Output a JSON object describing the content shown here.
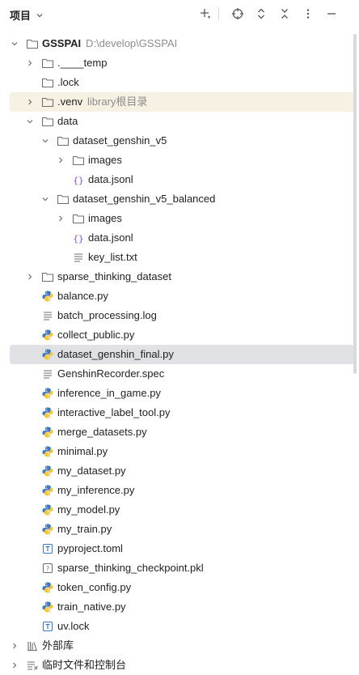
{
  "header": {
    "title": "项目"
  },
  "tree": [
    {
      "name": "root",
      "label": "GSSPAI",
      "path": "D:\\develop\\GSSPAI",
      "type": "folder",
      "depth": 0,
      "arrow": "down",
      "bold": true
    },
    {
      "name": "temp",
      "label": ".____temp",
      "type": "folder",
      "depth": 1,
      "arrow": "right"
    },
    {
      "name": "lock",
      "label": ".lock",
      "type": "folder",
      "depth": 1,
      "arrow": "none"
    },
    {
      "name": "venv",
      "label": ".venv",
      "path": "library根目录",
      "type": "folder",
      "depth": 1,
      "arrow": "right",
      "highlight": true
    },
    {
      "name": "data",
      "label": "data",
      "type": "folder",
      "depth": 1,
      "arrow": "down"
    },
    {
      "name": "dataset-genshin-v5",
      "label": "dataset_genshin_v5",
      "type": "folder",
      "depth": 2,
      "arrow": "down"
    },
    {
      "name": "images-1",
      "label": "images",
      "type": "folder",
      "depth": 3,
      "arrow": "right"
    },
    {
      "name": "data-jsonl-1",
      "label": "data.jsonl",
      "type": "json",
      "depth": 3,
      "arrow": "none"
    },
    {
      "name": "dataset-genshin-v5-balanced",
      "label": "dataset_genshin_v5_balanced",
      "type": "folder",
      "depth": 2,
      "arrow": "down"
    },
    {
      "name": "images-2",
      "label": "images",
      "type": "folder",
      "depth": 3,
      "arrow": "right"
    },
    {
      "name": "data-jsonl-2",
      "label": "data.jsonl",
      "type": "json",
      "depth": 3,
      "arrow": "none"
    },
    {
      "name": "key-list",
      "label": "key_list.txt",
      "type": "text",
      "depth": 3,
      "arrow": "none"
    },
    {
      "name": "sparse-thinking-dataset",
      "label": "sparse_thinking_dataset",
      "type": "folder",
      "depth": 1,
      "arrow": "right"
    },
    {
      "name": "balance",
      "label": "balance.py",
      "type": "python",
      "depth": 1,
      "arrow": "none"
    },
    {
      "name": "batch-processing-log",
      "label": "batch_processing.log",
      "type": "text",
      "depth": 1,
      "arrow": "none"
    },
    {
      "name": "collect-public",
      "label": "collect_public.py",
      "type": "python",
      "depth": 1,
      "arrow": "none"
    },
    {
      "name": "dataset-genshin-final",
      "label": "dataset_genshin_final.py",
      "type": "python",
      "depth": 1,
      "arrow": "none",
      "selected": true
    },
    {
      "name": "genshin-recorder-spec",
      "label": "GenshinRecorder.spec",
      "type": "text",
      "depth": 1,
      "arrow": "none"
    },
    {
      "name": "inference-in-game",
      "label": "inference_in_game.py",
      "type": "python",
      "depth": 1,
      "arrow": "none"
    },
    {
      "name": "interactive-label-tool",
      "label": "interactive_label_tool.py",
      "type": "python",
      "depth": 1,
      "arrow": "none"
    },
    {
      "name": "merge-datasets",
      "label": "merge_datasets.py",
      "type": "python",
      "depth": 1,
      "arrow": "none"
    },
    {
      "name": "minimal",
      "label": "minimal.py",
      "type": "python",
      "depth": 1,
      "arrow": "none"
    },
    {
      "name": "my-dataset",
      "label": "my_dataset.py",
      "type": "python",
      "depth": 1,
      "arrow": "none"
    },
    {
      "name": "my-inference",
      "label": "my_inference.py",
      "type": "python",
      "depth": 1,
      "arrow": "none"
    },
    {
      "name": "my-model",
      "label": "my_model.py",
      "type": "python",
      "depth": 1,
      "arrow": "none"
    },
    {
      "name": "my-train",
      "label": "my_train.py",
      "type": "python",
      "depth": 1,
      "arrow": "none"
    },
    {
      "name": "pyproject",
      "label": "pyproject.toml",
      "type": "toml",
      "depth": 1,
      "arrow": "none"
    },
    {
      "name": "sparse-thinking-checkpoint",
      "label": "sparse_thinking_checkpoint.pkl",
      "type": "unknown",
      "depth": 1,
      "arrow": "none"
    },
    {
      "name": "token-config",
      "label": "token_config.py",
      "type": "python",
      "depth": 1,
      "arrow": "none"
    },
    {
      "name": "train-native",
      "label": "train_native.py",
      "type": "python",
      "depth": 1,
      "arrow": "none"
    },
    {
      "name": "uv-lock",
      "label": "uv.lock",
      "type": "toml",
      "depth": 1,
      "arrow": "none"
    },
    {
      "name": "external-libraries",
      "label": "外部库",
      "type": "library",
      "depth": 0,
      "arrow": "right"
    },
    {
      "name": "scratches-consoles",
      "label": "临时文件和控制台",
      "type": "scratch",
      "depth": 0,
      "arrow": "right"
    }
  ]
}
